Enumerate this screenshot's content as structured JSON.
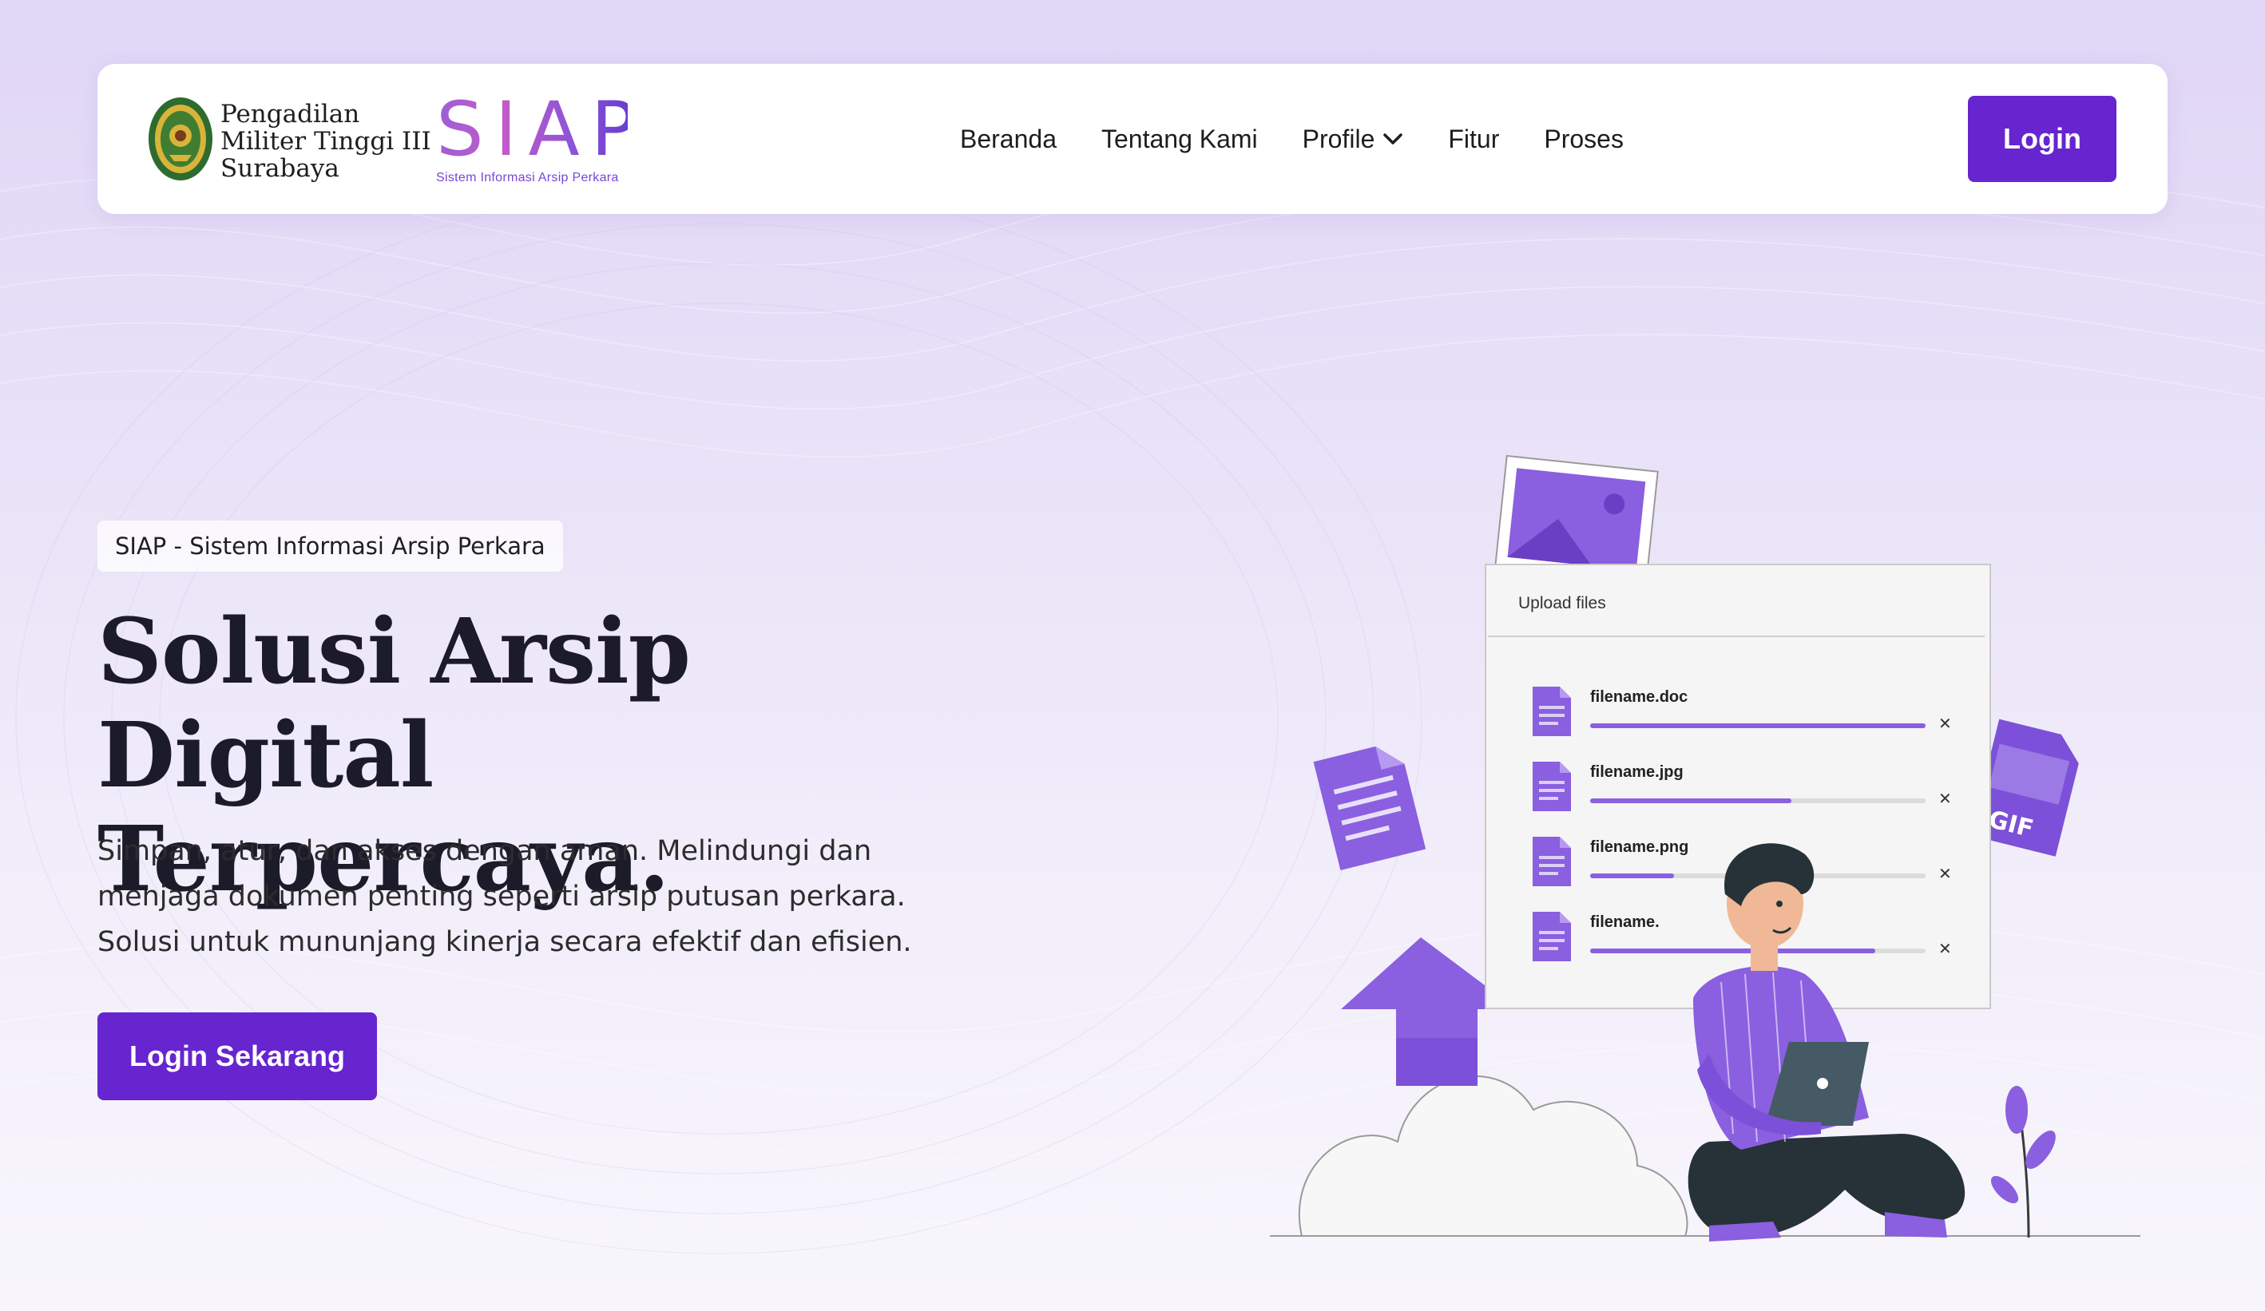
{
  "header": {
    "court_name_lines": [
      "Pengadilan",
      "Militer Tinggi III",
      "Surabaya"
    ],
    "brand_word": "SIAP",
    "brand_subtitle": "Sistem Informasi Arsip Perkara",
    "nav": [
      {
        "label": "Beranda"
      },
      {
        "label": "Tentang Kami"
      },
      {
        "label": "Profile",
        "icon": "chevron-down-icon"
      },
      {
        "label": "Fitur"
      },
      {
        "label": "Proses"
      }
    ],
    "login_label": "Login"
  },
  "hero": {
    "badge": "SIAP - Sistem Informasi Arsip Perkara",
    "title_lines": [
      "Solusi Arsip Digital",
      "Terpercaya."
    ],
    "description": "Simpan, atur, dan akses dengan aman. Melindungi dan menjaga dokumen penting seperti arsip putusan perkara. Solusi untuk mununjang kinerja secara efektif dan efisien.",
    "cta_label": "Login Sekarang"
  },
  "illustration": {
    "upload_title": "Upload files",
    "files": [
      {
        "name": "filename.doc",
        "progress": 1.0
      },
      {
        "name": "filename.jpg",
        "progress": 0.6
      },
      {
        "name": "filename.png",
        "progress": 0.25
      },
      {
        "name": "filename.",
        "progress": 0.85
      }
    ],
    "gif_label": "GIF"
  },
  "colors": {
    "primary": "#6625cf",
    "accent_purple": "#8a5fe0",
    "background_top": "#e0d6f6"
  }
}
